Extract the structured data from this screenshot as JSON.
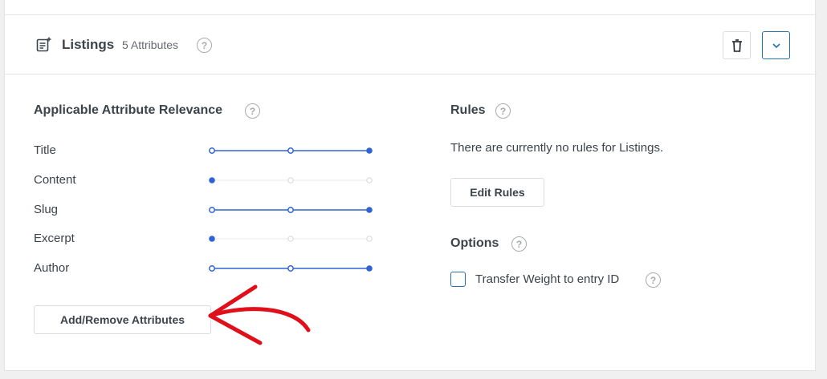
{
  "source": {
    "title": "Listings",
    "count_label": "5 Attributes",
    "help": "?"
  },
  "relevance": {
    "title": "Applicable Attribute Relevance",
    "help": "?",
    "attributes": [
      {
        "label": "Title",
        "level": 3
      },
      {
        "label": "Content",
        "level": 1
      },
      {
        "label": "Slug",
        "level": 3
      },
      {
        "label": "Excerpt",
        "level": 1
      },
      {
        "label": "Author",
        "level": 3
      }
    ],
    "add_remove_label": "Add/Remove Attributes"
  },
  "rules": {
    "title": "Rules",
    "help": "?",
    "empty_text": "There are currently no rules for Listings.",
    "edit_label": "Edit Rules"
  },
  "options": {
    "title": "Options",
    "help": "?",
    "transfer_weight_label": "Transfer Weight to entry ID",
    "transfer_weight_checked": false,
    "help2": "?"
  },
  "colors": {
    "accent": "#2f63d2",
    "inactive": "#dcdcde",
    "annotation": "#e0101b"
  },
  "icons": {
    "source": "document-list-icon",
    "delete": "trash-icon",
    "toggle": "chevron-down-icon",
    "annotation": "red-arrow-icon"
  }
}
